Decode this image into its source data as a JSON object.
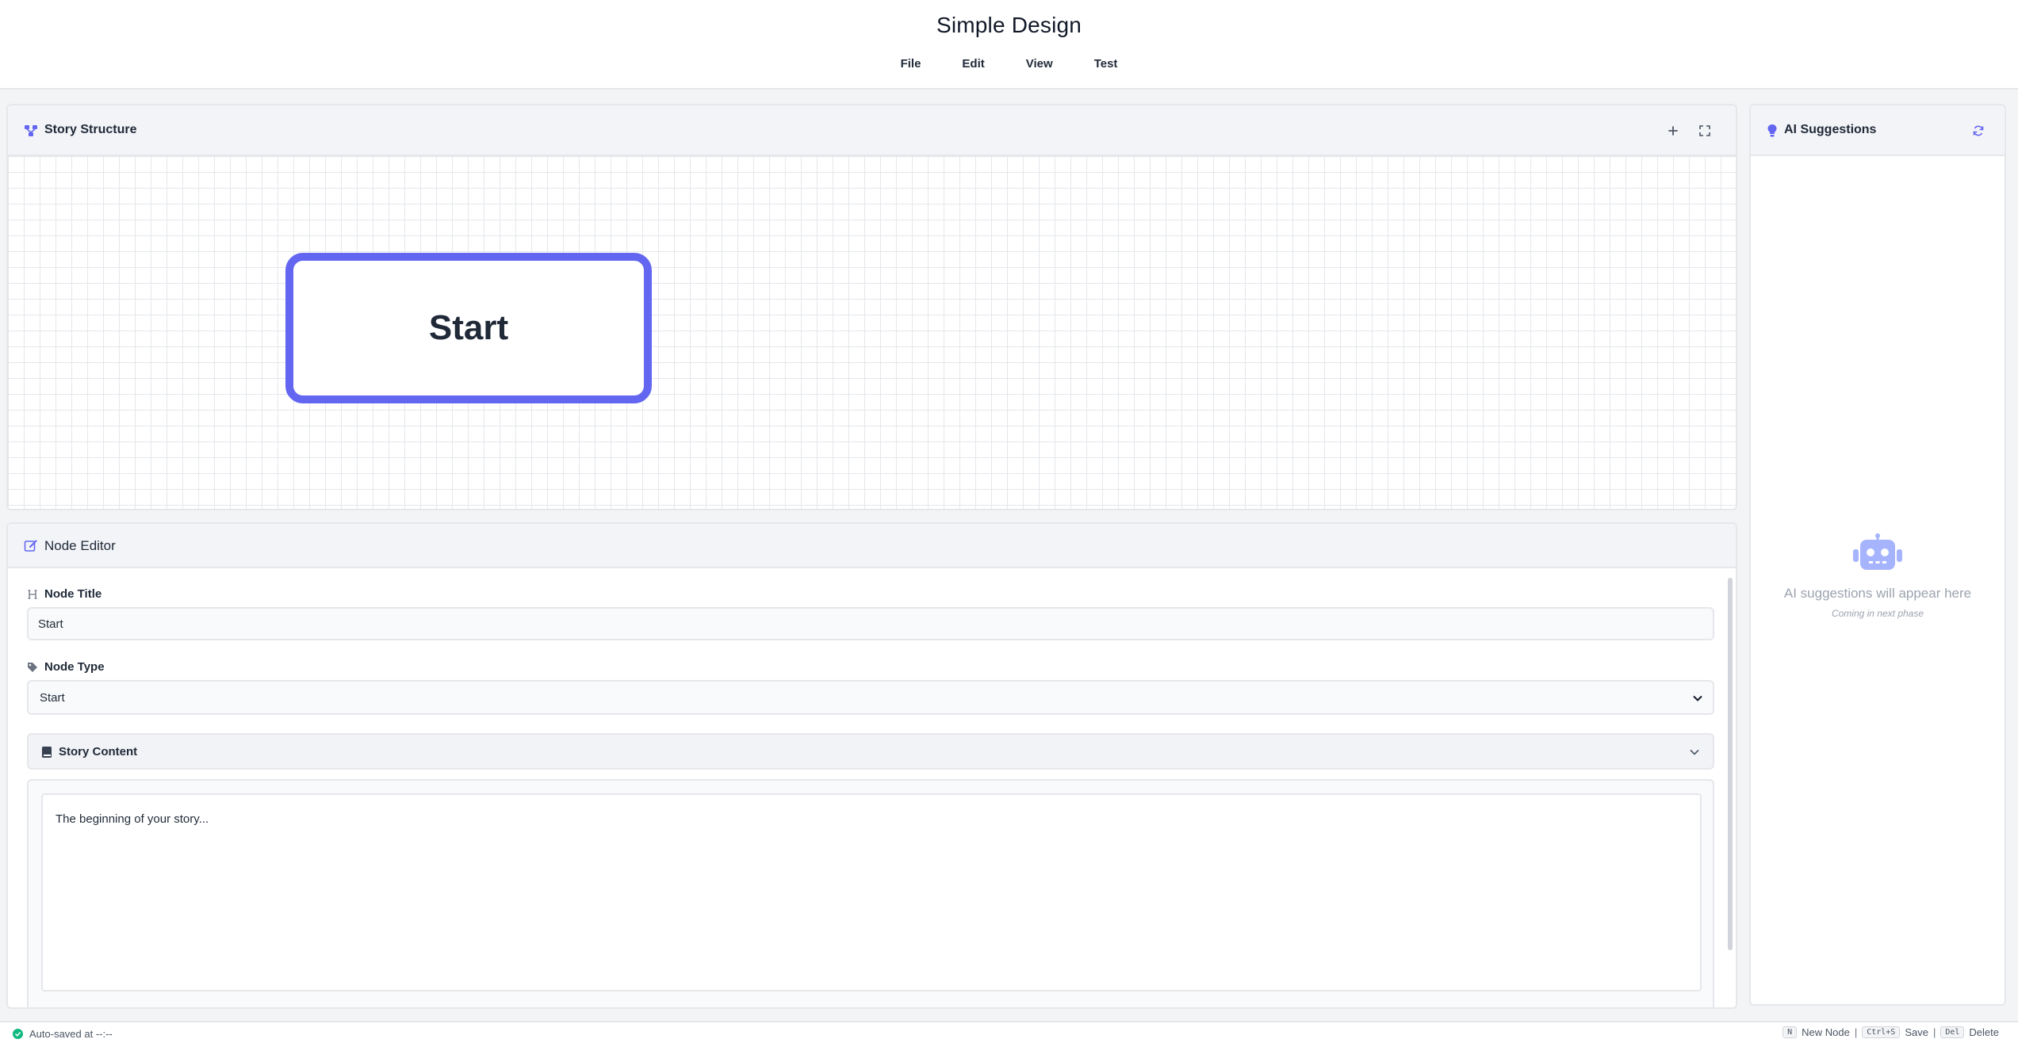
{
  "app": {
    "title": "Simple Design"
  },
  "menu": [
    "File",
    "Edit",
    "View",
    "Test"
  ],
  "structure": {
    "title": "Story Structure",
    "nodes": [
      {
        "label": "Start"
      }
    ]
  },
  "editor": {
    "title": "Node Editor",
    "node_title_label": "Node Title",
    "node_title_value": "Start",
    "node_type_label": "Node Type",
    "node_type_value": "Start",
    "story_content_label": "Story Content",
    "story_content_value": "The beginning of your story..."
  },
  "ai": {
    "title": "AI Suggestions",
    "empty_message": "AI suggestions will appear here",
    "empty_sub": "Coming in next phase"
  },
  "status": {
    "autosave": "Auto-saved at --:--",
    "shortcuts": [
      {
        "key": "N",
        "label": "New Node"
      },
      {
        "key": "Ctrl+S",
        "label": "Save"
      },
      {
        "key": "Del",
        "label": "Delete"
      }
    ]
  },
  "colors": {
    "accent": "#6366f1",
    "success": "#10b981"
  }
}
